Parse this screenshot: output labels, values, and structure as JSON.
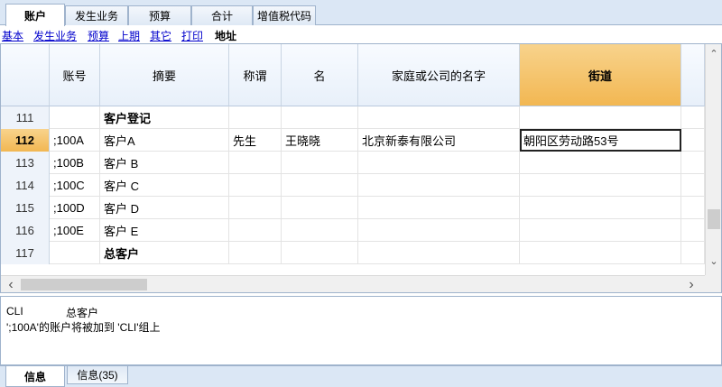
{
  "tabs": [
    "账户",
    "发生业务",
    "预算",
    "合计",
    "增值税代码"
  ],
  "views": [
    "基本",
    "发生业务",
    "预算",
    "上期",
    "其它",
    "打印",
    "地址"
  ],
  "current_view": "地址",
  "columns": [
    "账号",
    "摘要",
    "称谓",
    "名",
    "家庭或公司的名字",
    "街道"
  ],
  "rows": [
    {
      "num": "111",
      "acct": "",
      "desc": "客户登记",
      "title": "",
      "first": "",
      "company": "",
      "street": ""
    },
    {
      "num": "112",
      "acct": ";100A",
      "desc": "客户A",
      "title": "先生",
      "first": "王晓晓",
      "company": "北京新泰有限公司",
      "street": "朝阳区劳动路53号"
    },
    {
      "num": "113",
      "acct": ";100B",
      "desc": "客户 B",
      "title": "",
      "first": "",
      "company": "",
      "street": ""
    },
    {
      "num": "114",
      "acct": ";100C",
      "desc": "客户 C",
      "title": "",
      "first": "",
      "company": "",
      "street": ""
    },
    {
      "num": "115",
      "acct": ";100D",
      "desc": "客户 D",
      "title": "",
      "first": "",
      "company": "",
      "street": ""
    },
    {
      "num": "116",
      "acct": ";100E",
      "desc": "客户 E",
      "title": "",
      "first": "",
      "company": "",
      "street": ""
    },
    {
      "num": "117",
      "acct": "",
      "desc": "总客户",
      "title": "",
      "first": "",
      "company": "",
      "street": ""
    }
  ],
  "info": {
    "code": "CLI",
    "name": "总客户",
    "message": "';100A'的账户将被加到 'CLI'组上"
  },
  "bottom_tabs": [
    "信息",
    "信息(35)"
  ],
  "scroll": {
    "up": "⌃",
    "down": "⌄",
    "left": "‹",
    "right": "›"
  }
}
